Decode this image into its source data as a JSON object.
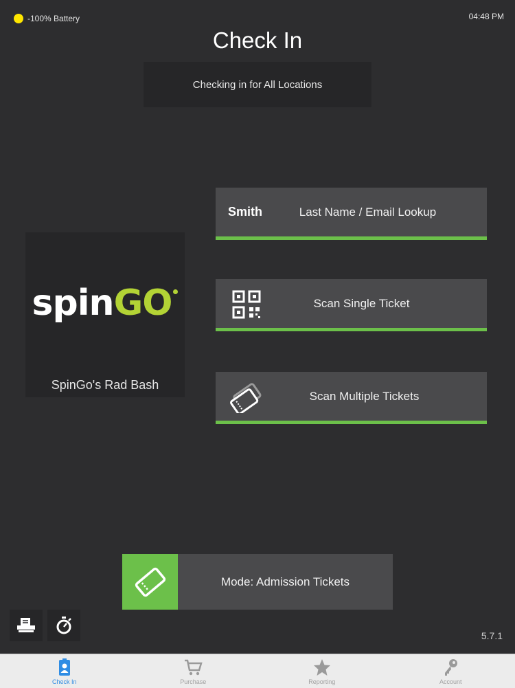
{
  "status_bar": {
    "battery": "-100% Battery",
    "time": "04:48 PM",
    "battery_color": "#ffe600"
  },
  "header": {
    "title": "Check In",
    "location_banner": "Checking in for All Locations"
  },
  "event": {
    "logo_text_1": "spin",
    "logo_text_2": "GO",
    "name": "SpinGo's Rad Bash",
    "logo_accent": "#b3d335"
  },
  "actions": {
    "lookup": {
      "prefix": "Smith",
      "label": "Last Name / Email Lookup"
    },
    "scan_single": {
      "label": "Scan Single Ticket",
      "icon": "qr-code-icon"
    },
    "scan_multiple": {
      "label": "Scan Multiple Tickets",
      "icon": "tickets-icon"
    }
  },
  "mode": {
    "label": "Mode: Admission Tickets",
    "icon": "ticket-icon",
    "accent": "#6cc04a"
  },
  "tools": {
    "printer": "printer-icon",
    "timer": "stopwatch-icon"
  },
  "version": "5.7.1",
  "tabs": [
    {
      "label": "Check In",
      "icon": "badge-icon",
      "active": true
    },
    {
      "label": "Purchase",
      "icon": "cart-icon",
      "active": false
    },
    {
      "label": "Reporting",
      "icon": "star-icon",
      "active": false
    },
    {
      "label": "Account",
      "icon": "key-icon",
      "active": false
    }
  ]
}
